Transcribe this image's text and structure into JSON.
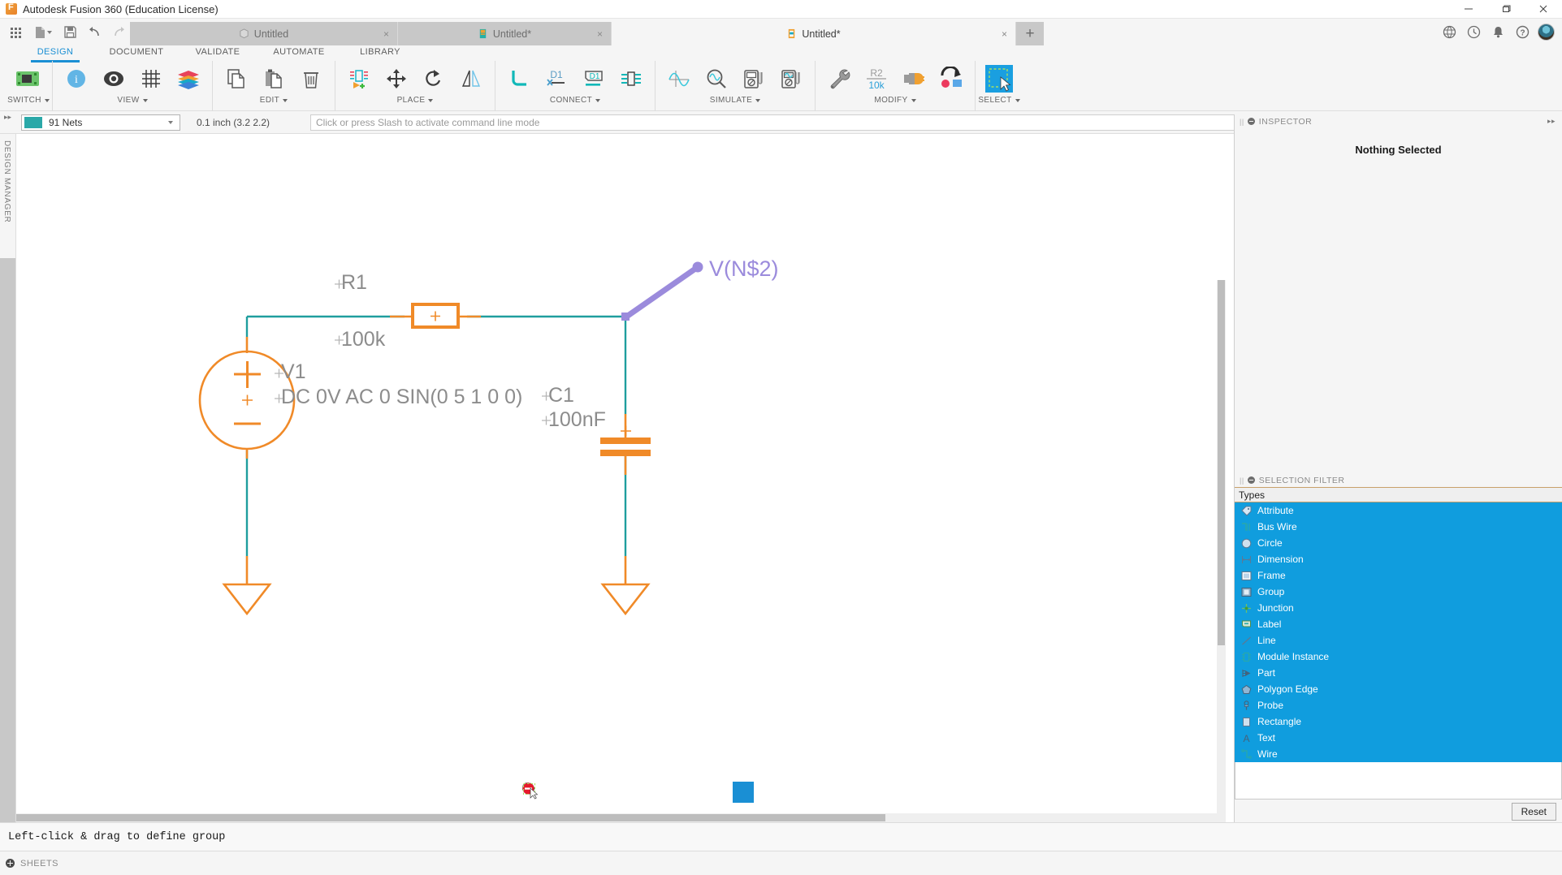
{
  "window": {
    "title": "Autodesk Fusion 360 (Education License)",
    "app_icon": "fusion-logo-icon",
    "minimize": "minimize-icon",
    "maximize": "restore-icon",
    "close": "close-icon"
  },
  "quick_access": {
    "buttons": [
      {
        "name": "app-grid-icon",
        "label": "grid"
      },
      {
        "name": "new-document-icon",
        "label": "new"
      },
      {
        "name": "save-icon",
        "label": "save"
      },
      {
        "name": "undo-icon",
        "label": "undo"
      },
      {
        "name": "redo-icon",
        "label": "redo"
      }
    ]
  },
  "tabs": [
    {
      "label": "Untitled",
      "icon": "cube-icon",
      "close": "×",
      "active": false,
      "modified": false
    },
    {
      "label": "Untitled*",
      "icon": "pcb-board-icon",
      "close": "×",
      "active": false,
      "modified": true
    },
    {
      "label": "Untitled*",
      "icon": "schematic-icon",
      "close": "×",
      "active": true,
      "modified": true
    }
  ],
  "tabs_right": [
    {
      "name": "new-tab-plus",
      "glyph": "+"
    },
    {
      "name": "globe-icon",
      "glyph": ""
    },
    {
      "name": "history-clock-icon",
      "glyph": ""
    },
    {
      "name": "notifications-bell-icon",
      "glyph": ""
    },
    {
      "name": "help-icon",
      "glyph": "?"
    },
    {
      "name": "account-avatar",
      "glyph": ""
    }
  ],
  "ribbon": {
    "tabs": [
      {
        "label": "DESIGN",
        "active": true
      },
      {
        "label": "DOCUMENT",
        "active": false
      },
      {
        "label": "VALIDATE",
        "active": false
      },
      {
        "label": "AUTOMATE",
        "active": false
      },
      {
        "label": "LIBRARY",
        "active": false
      }
    ],
    "groups": [
      {
        "label": "SWITCH",
        "has_caret": true,
        "icons": [
          {
            "name": "switch-to-pcb-icon"
          }
        ]
      },
      {
        "label": "VIEW",
        "has_caret": true,
        "icons": [
          {
            "name": "info-icon"
          },
          {
            "name": "display-target-icon"
          },
          {
            "name": "grid-icon"
          },
          {
            "name": "layers-icon"
          }
        ]
      },
      {
        "label": "EDIT",
        "has_caret": true,
        "icons": [
          {
            "name": "copy-icon"
          },
          {
            "name": "paste-icon"
          },
          {
            "name": "delete-trash-icon"
          }
        ]
      },
      {
        "label": "PLACE",
        "has_caret": true,
        "icons": [
          {
            "name": "place-component-icon"
          },
          {
            "name": "move-icon"
          },
          {
            "name": "rotate-icon"
          },
          {
            "name": "mirror-icon"
          }
        ]
      },
      {
        "label": "CONNECT",
        "has_caret": true,
        "icons": [
          {
            "name": "net-wire-icon"
          },
          {
            "name": "delete-net-icon"
          },
          {
            "name": "name-label-icon"
          },
          {
            "name": "bus-icon"
          }
        ]
      },
      {
        "label": "SIMULATE",
        "has_caret": true,
        "icons": [
          {
            "name": "waveform-icon"
          },
          {
            "name": "probe-search-icon"
          },
          {
            "name": "dc-meter-icon"
          },
          {
            "name": "ac-meter-icon"
          }
        ]
      },
      {
        "label": "MODIFY",
        "has_caret": true,
        "icons": [
          {
            "name": "wrench-icon"
          },
          {
            "name": "value-r2-10k-icon"
          },
          {
            "name": "swap-gate-icon"
          },
          {
            "name": "replace-icon"
          }
        ]
      },
      {
        "label": "SELECT",
        "has_caret": true,
        "icons": [
          {
            "name": "select-rectangle-icon"
          }
        ]
      }
    ],
    "modify_badge": {
      "top": "R2",
      "bottom": "10k"
    }
  },
  "netbar": {
    "expand_icon": "▸▸",
    "net_selector": {
      "value": "91 Nets",
      "swatch_color": "#2aa8a8",
      "caret": "chevron-down-icon"
    },
    "coords": "0.1 inch (3.2 2.2)",
    "command_line_placeholder": "Click or press Slash to activate command line mode",
    "command_line_value": ""
  },
  "left_rail": {
    "label": "DESIGN MANAGER",
    "expand_icon": "▸▸"
  },
  "schematic": {
    "components": [
      {
        "ref": "R1",
        "value": "100k",
        "type": "resistor"
      },
      {
        "ref": "V1",
        "value": "DC 0V AC 0 SIN(0 5 1 0 0)",
        "type": "voltage-source"
      },
      {
        "ref": "C1",
        "value": "100nF",
        "type": "capacitor"
      }
    ],
    "probe": {
      "label": "V(N$2)",
      "color": "#9b8bdc"
    },
    "wire_color": "#1f9e9e",
    "symbol_color": "#f08a28",
    "text_color": "#8c8c8c"
  },
  "mini_toolbar": [
    {
      "name": "info-icon"
    },
    {
      "name": "display-icon"
    },
    {
      "name": "undo-icon"
    },
    {
      "name": "redo-icon"
    },
    {
      "name": "zoom-in-icon"
    },
    {
      "name": "zoom-out-icon"
    },
    {
      "name": "zoom-fit-icon"
    },
    {
      "name": "grid-icon"
    },
    {
      "name": "zoom-extents-icon"
    },
    {
      "name": "stop-icon"
    },
    {
      "name": "select-tool-icon"
    }
  ],
  "inspector": {
    "title": "INSPECTOR",
    "empty_text": "Nothing Selected",
    "expand_icon": "▸▸"
  },
  "selection_filter": {
    "title": "SELECTION FILTER",
    "column_header": "Types",
    "items": [
      {
        "label": "Attribute",
        "icon": "attribute-tag-icon",
        "selected": true
      },
      {
        "label": "Bus Wire",
        "icon": "bus-wire-icon",
        "selected": true
      },
      {
        "label": "Circle",
        "icon": "circle-icon",
        "selected": true
      },
      {
        "label": "Dimension",
        "icon": "dimension-icon",
        "selected": true
      },
      {
        "label": "Frame",
        "icon": "frame-icon",
        "selected": true
      },
      {
        "label": "Group",
        "icon": "group-icon",
        "selected": true
      },
      {
        "label": "Junction",
        "icon": "junction-icon",
        "selected": true
      },
      {
        "label": "Label",
        "icon": "label-icon",
        "selected": true
      },
      {
        "label": "Line",
        "icon": "line-icon",
        "selected": true
      },
      {
        "label": "Module Instance",
        "icon": "module-instance-icon",
        "selected": true
      },
      {
        "label": "Part",
        "icon": "part-icon",
        "selected": true
      },
      {
        "label": "Polygon Edge",
        "icon": "polygon-edge-icon",
        "selected": true
      },
      {
        "label": "Probe",
        "icon": "probe-icon",
        "selected": true
      },
      {
        "label": "Rectangle",
        "icon": "rectangle-icon",
        "selected": true
      },
      {
        "label": "Text",
        "icon": "text-icon",
        "selected": true
      },
      {
        "label": "Wire",
        "icon": "wire-icon",
        "selected": true
      }
    ],
    "reset_label": "Reset",
    "highlight_color": "#109dde"
  },
  "status": {
    "message": "Left-click & drag to define group"
  },
  "sheets": {
    "label": "SHEETS",
    "add_icon": "plus-circle-icon"
  }
}
